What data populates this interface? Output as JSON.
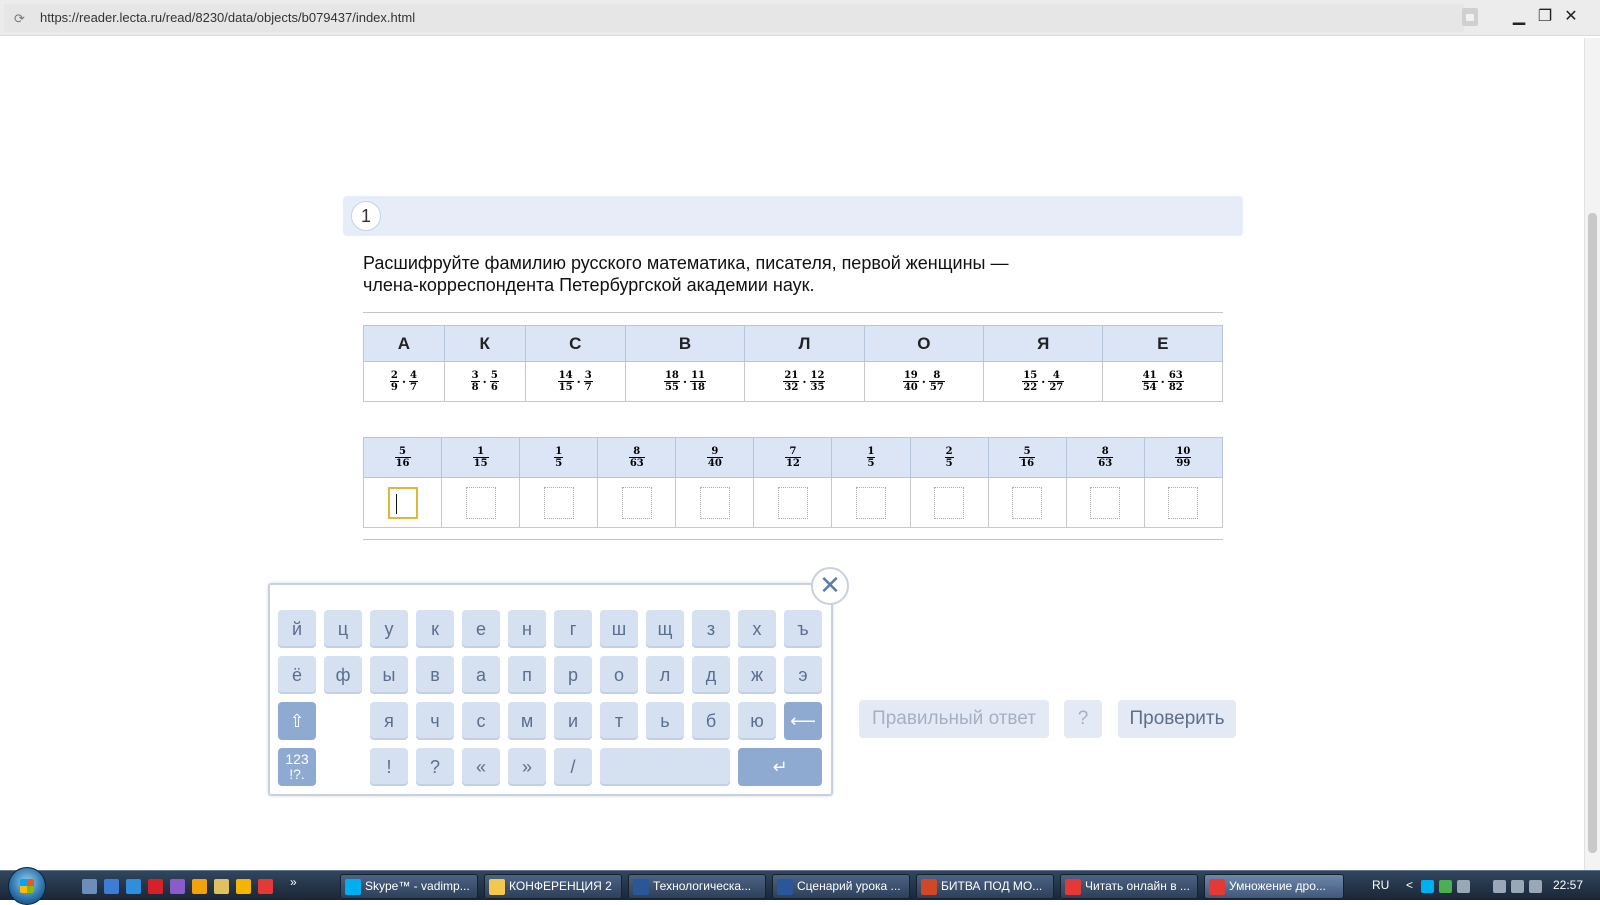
{
  "browser": {
    "url": "https://reader.lecta.ru/read/8230/data/objects/b079437/index.html",
    "reload_icon": "⟳",
    "minimize": "▁",
    "maximize": "❐",
    "close": "✕"
  },
  "task": {
    "number": "1",
    "line1": "Расшифруйте фамилию русского математика, писателя, первой женщины —",
    "line2": "члена-корреспондента Петербургской академии наук."
  },
  "key_table": {
    "letters": [
      "А",
      "К",
      "С",
      "В",
      "Л",
      "О",
      "Я",
      "Е"
    ],
    "expressions": [
      [
        [
          "2",
          "9"
        ],
        [
          "4",
          "7"
        ]
      ],
      [
        [
          "3",
          "8"
        ],
        [
          "5",
          "6"
        ]
      ],
      [
        [
          "14",
          "15"
        ],
        [
          "3",
          "7"
        ]
      ],
      [
        [
          "18",
          "55"
        ],
        [
          "11",
          "18"
        ]
      ],
      [
        [
          "21",
          "32"
        ],
        [
          "12",
          "35"
        ]
      ],
      [
        [
          "19",
          "40"
        ],
        [
          "8",
          "57"
        ]
      ],
      [
        [
          "15",
          "22"
        ],
        [
          "4",
          "27"
        ]
      ],
      [
        [
          "41",
          "54"
        ],
        [
          "63",
          "82"
        ]
      ]
    ],
    "operator": "·"
  },
  "answer_table": {
    "fractions": [
      [
        "5",
        "16"
      ],
      [
        "1",
        "15"
      ],
      [
        "1",
        "5"
      ],
      [
        "8",
        "63"
      ],
      [
        "9",
        "40"
      ],
      [
        "7",
        "12"
      ],
      [
        "1",
        "5"
      ],
      [
        "2",
        "5"
      ],
      [
        "5",
        "16"
      ],
      [
        "8",
        "63"
      ],
      [
        "10",
        "99"
      ]
    ]
  },
  "keyboard": {
    "close_icon": "✕",
    "row1": [
      "й",
      "ц",
      "у",
      "к",
      "е",
      "н",
      "г",
      "ш",
      "щ",
      "з",
      "х",
      "ъ"
    ],
    "row2": [
      "ё",
      "ф",
      "ы",
      "в",
      "а",
      "п",
      "р",
      "о",
      "л",
      "д",
      "ж",
      "э"
    ],
    "row3": [
      "я",
      "ч",
      "с",
      "м",
      "и",
      "т",
      "ь",
      "б",
      "ю"
    ],
    "row4": [
      "!",
      "?",
      "«",
      "»",
      "/"
    ],
    "shift_icon": "⇧",
    "backspace_icon": "⟵",
    "enter_icon": "↵",
    "num_key": "123\n!?."
  },
  "buttons": {
    "correct_answer": "Правильный ответ",
    "help": "?",
    "check": "Проверить"
  },
  "taskbar": {
    "items": [
      {
        "label": "Skype™ - vadimp...",
        "color": "#00aff0"
      },
      {
        "label": "КОНФЕРЕНЦИЯ 2",
        "color": "#f2c94c"
      },
      {
        "label": "Технологическа...",
        "color": "#2b579a"
      },
      {
        "label": "Сценарий урока ...",
        "color": "#2b579a"
      },
      {
        "label": "БИТВА ПОД МО...",
        "color": "#d24726"
      },
      {
        "label": "Читать онлайн в ...",
        "color": "#e53935"
      },
      {
        "label": "Умножение дро...",
        "color": "#e53935"
      }
    ],
    "lang": "RU",
    "time": "22:57",
    "more_icon": "»",
    "tray_arrow": "<"
  }
}
